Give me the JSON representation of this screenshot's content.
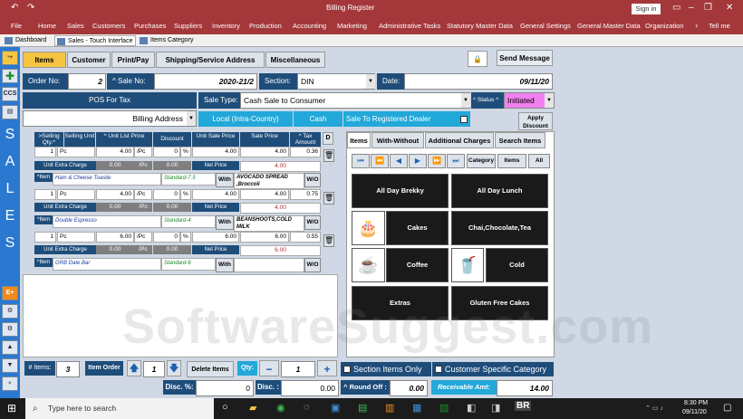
{
  "titlebar": {
    "title": "Billing Register",
    "signin": "Sign in"
  },
  "menu": [
    "File",
    "Home",
    "Sales",
    "Customers",
    "Purchases",
    "Suppliers",
    "Inventory",
    "Production",
    "Accounting",
    "Marketing",
    "Administrative Tasks",
    "Statutory Master Data",
    "General Settings",
    "General Master Data",
    "Organization",
    "Tell me"
  ],
  "doctabs": [
    "Dashboard",
    "Sales - Touch Interface",
    "Items Category"
  ],
  "sidebar": {
    "ccs": "CCS",
    "letters": [
      "S",
      "A",
      "L",
      "E",
      "S"
    ],
    "eplus": "E+"
  },
  "toptabs": [
    "Items",
    "Customer",
    "Print/Pay",
    "Shipping/Service Address",
    "Miscellaneous"
  ],
  "send_message": "Send Message",
  "order": {
    "order_no_label": "Order No:",
    "order_no": "2",
    "sale_no_label": "^ Sale No:",
    "sale_no": "2020-21/2",
    "section_label": "Section:",
    "section": "DIN",
    "date_label": "Date:",
    "date": "09/11/20"
  },
  "pos_tax": "POS For Tax",
  "billing_address": "Billing Address",
  "sale_type_label": "Sale Type:",
  "sale_type": "Cash Sale to Consumer",
  "status_label": "^ Status ^",
  "status": "Initiated",
  "tax_buttons": [
    "Local (Intra-Country)",
    "Cash",
    "Sale To Registered Dealer"
  ],
  "apply_discount": "Apply Discount",
  "grid_headers": [
    ">Selling Qty.^",
    "Selling Unit",
    "^ Unit List Price",
    "Discount",
    "Unit Sale Price",
    "Sale Price",
    "^ Tax Amount",
    "D"
  ],
  "rows": [
    {
      "qty": "1",
      "unit": "Pc",
      "price": "4.00",
      "per": "/Pc",
      "disc": "0",
      "pct": "%",
      "usp": "4.00",
      "sp": "4.00",
      "tax": "0.36",
      "extra": "0.00",
      "extra_unit": "/Pc",
      "extra_disc": "0.00",
      "net": "4.00",
      "item": "Ham & Cheese Toastie",
      "taxcls": "Standard-7.5",
      "with": "AVOCADO SPREAD ,Broccoli"
    },
    {
      "qty": "1",
      "unit": "Pc",
      "price": "4.00",
      "per": "/Pc",
      "disc": "0",
      "pct": "%",
      "usp": "4.00",
      "sp": "4.00",
      "tax": "0.75",
      "extra": "0.00",
      "extra_unit": "/Pc",
      "extra_disc": "0.00",
      "net": "4.00",
      "item": "Double Espresso",
      "taxcls": "Standard-4",
      "with": "BEANSHOOTS,COLD MILK"
    },
    {
      "qty": "1",
      "unit": "Pc",
      "price": "6.00",
      "per": "/Pc",
      "disc": "0",
      "pct": "%",
      "usp": "6.00",
      "sp": "6.00",
      "tax": "0.55",
      "extra": "0.00",
      "extra_unit": "/Pc",
      "extra_disc": "0.00",
      "net": "6.00",
      "item": "GRB Date Bar",
      "taxcls": "Standard-6",
      "with": ""
    }
  ],
  "row_labels": {
    "unit_extra": "Unit Extra Charge",
    "net_price": "Net Price",
    "item": "^Item",
    "with": "With",
    "wo": "W/O"
  },
  "right_tabs": [
    "Items",
    "With-Without",
    "Additional Charges",
    "Search Items"
  ],
  "nav_buttons": [
    "Category",
    "Items",
    "All"
  ],
  "tiles": [
    "All Day Brekky",
    "All Day Lunch",
    "Cakes",
    "Chai,Chocolate,Tea",
    "Coffee",
    "Cold",
    "Extras",
    "Gluten Free Cakes"
  ],
  "bottom": {
    "items_label": "# Items:",
    "items": "3",
    "item_order": "Item Order",
    "order_val": "1",
    "delete_items": "Delete Items",
    "qty_label": "Qty:",
    "qty": "1",
    "section_items": "Section Items Only",
    "customer_category": "Customer Specific Category",
    "disc_pct_label": "Disc. %:",
    "disc_pct": "0",
    "disc_label": "Disc. :",
    "disc": "0.00",
    "roundoff_label": "^ Round Off :",
    "roundoff": "0.00",
    "receivable_label": "Receivable Amt:",
    "receivable": "14.00"
  },
  "taskbar": {
    "search": "Type here to search",
    "time": "8:30 PM",
    "date": "09/11/20"
  },
  "watermark": "SoftwareSuggest.com"
}
